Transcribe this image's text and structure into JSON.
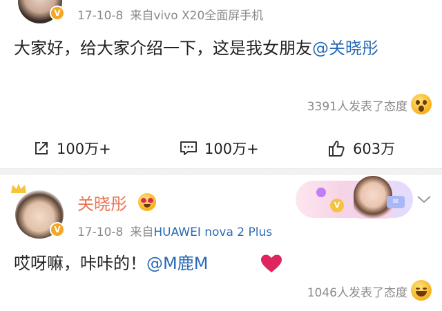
{
  "post1": {
    "date": "17-10-8",
    "source": "来自vivo X20全面屏手机",
    "text_main": "大家好，给大家介绍一下，这是我女朋友",
    "mention": "@关晓彤",
    "reaction_count": "3391人发表了态度",
    "actions": {
      "share": "100万+",
      "comment": "100万+",
      "like": "603万"
    }
  },
  "post2": {
    "username": "关晓彤",
    "date": "17-10-8",
    "source_prefix": "来自",
    "device": "HUAWEI nova 2 Plus",
    "text_main": "哎呀嘛，咔咔的！",
    "mention": "@M鹿M",
    "reaction_count": "1046人发表了态度"
  },
  "icons": {
    "share": "share-icon",
    "comment": "comment-icon",
    "like": "thumbs-up-icon",
    "verified": "verified-badge-icon",
    "chevron": "chevron-down-icon",
    "heart": "red-heart-emoji"
  },
  "colors": {
    "mention": "#2a6bb5",
    "username": "#eb7350",
    "meta": "#8a8a8a",
    "verified": "#f5a623"
  }
}
